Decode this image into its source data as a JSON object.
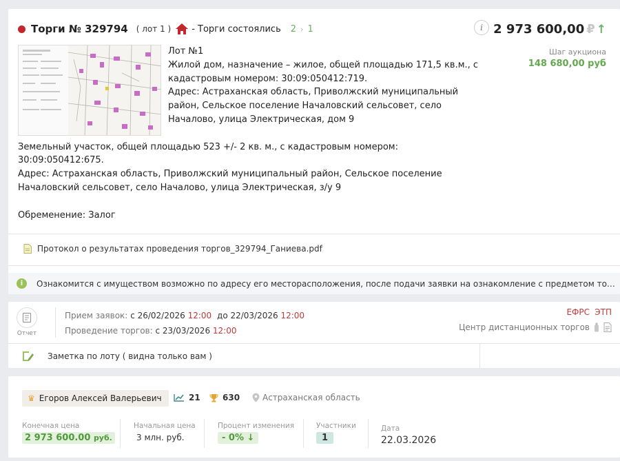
{
  "lot_card": {
    "title": "Торги № 329794",
    "lot_badge": "( лот 1 )",
    "status": "- Торги состоялись",
    "step_from": "2",
    "step_sep": "›",
    "step_to": "1",
    "info_icon_label": "i",
    "price": "2 973 600,00",
    "currency": "₽",
    "price_trend": "↑",
    "auction_step_label": "Шаг аукциона",
    "auction_step_value": "148 680,00 руб",
    "description": {
      "line_lot": "Лот №1",
      "line_house": "Жилой дом, назначение – жилое, общей площадью 171,5 кв.м., с кадастровым номером: 30:09:050412:719.",
      "line_house_addr": "Адрес: Астраханская область, Приволжский муниципальный район, Сельское поселение Началовский сельсовет, село Началово, улица Электрическая, дом 9",
      "line_land": "Земельный участок, общей площадью 523 +/- 2 кв. м., с кадастровым номером: 30:09:050412:675.",
      "line_land_addr": "Адрес: Астраханская область, Приволжский муниципальный район, Сельское поселение Началовский сельсовет, село Началово, улица Электрическая, з/у 9",
      "line_burden": "Обременение: Залог"
    },
    "document": "Протокол о результатах проведения торгов_329794_Ганиева.pdf",
    "notice": "Ознакомится с имуществом возможно по адресу его месторасположения, после подачи заявки на ознакомление с предметом торгов, в рабочие дни"
  },
  "schedule_card": {
    "report_label": "Отчет",
    "applications_label": "Прием заявок:",
    "applications_from": "с 26/02/2026",
    "applications_from_time": "12:00",
    "applications_to": "до 22/03/2026",
    "applications_to_time": "12:00",
    "auction_label": "Проведение торгов:",
    "auction_from": "с 23/03/2026",
    "auction_time": "12:00",
    "efrs": "ЕФРС",
    "etp": "ЭТП",
    "platform": "Центр дистанционных торгов",
    "note": "Заметка по лоту ( видна только вам )"
  },
  "result_card": {
    "agent_name": "Егоров Алексей Валерьевич",
    "trend_count": "21",
    "trophy_count": "630",
    "region": "Астраханская область",
    "final_price_label": "Конечная цена",
    "final_price_value": "2 973 600.00",
    "final_price_unit": "руб.",
    "start_price_label": "Начальная цена",
    "start_price_value": "3 млн. руб.",
    "change_label": "Процент изменения",
    "change_value": "- 0%",
    "change_arrow": "↓",
    "participants_label": "Участники",
    "participants_value": "1",
    "date_label": "Дата",
    "date_value": "22.03.2026"
  },
  "colors": {
    "accent_green": "#65a84e",
    "accent_red": "#c0393b",
    "status_dot": "#c3262b"
  }
}
